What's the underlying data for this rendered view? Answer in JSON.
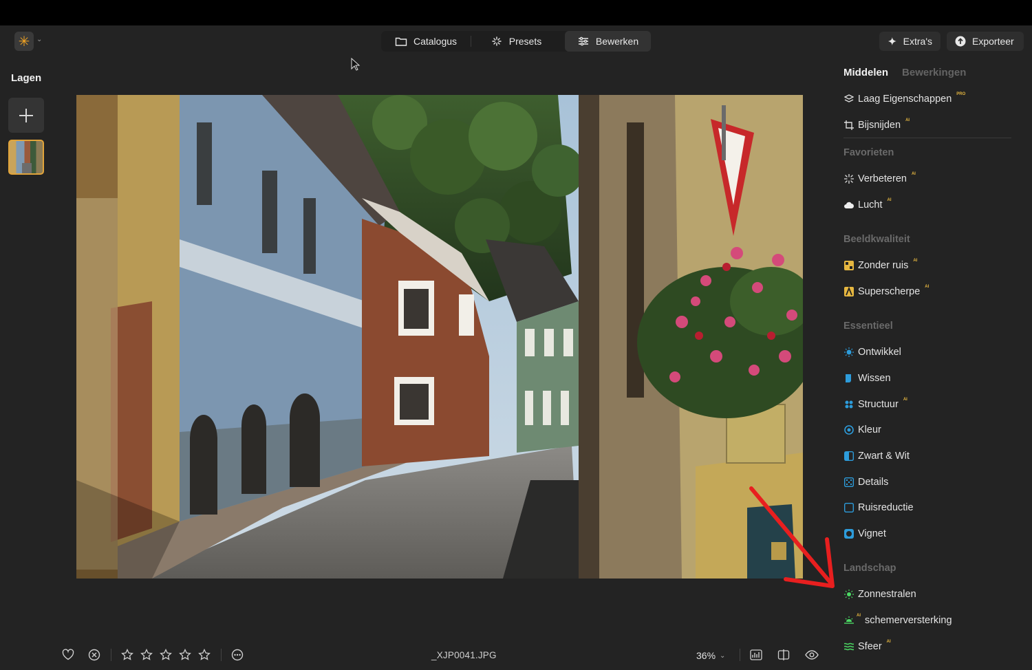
{
  "header": {
    "tabs": [
      {
        "label": "Catalogus",
        "icon": "folder-icon"
      },
      {
        "label": "Presets",
        "icon": "sparkle-icon"
      },
      {
        "label": "Bewerken",
        "icon": "sliders-icon"
      }
    ],
    "extras_label": "Extra's",
    "export_label": "Exporteer"
  },
  "layers": {
    "title": "Lagen"
  },
  "panel": {
    "tab_active": "Middelen",
    "tab_inactive": "Bewerkingen",
    "tools_top": [
      {
        "label": "Laag Eigenschappen",
        "badge": "PRO"
      },
      {
        "label": "Bijsnijden",
        "badge": "AI"
      }
    ],
    "sections": [
      "Favorieten",
      "Beeldkwaliteit",
      "Essentieel",
      "Landschap"
    ],
    "favorieten": [
      {
        "label": "Verbeteren",
        "badge": "AI"
      },
      {
        "label": "Lucht",
        "badge": "AI"
      }
    ],
    "beeldkwaliteit": [
      {
        "label": "Zonder ruis",
        "badge": "AI"
      },
      {
        "label": "Superscherpe",
        "badge": "AI"
      }
    ],
    "essentieel": [
      {
        "label": "Ontwikkel"
      },
      {
        "label": "Wissen"
      },
      {
        "label": "Structuur",
        "badge": "AI"
      },
      {
        "label": "Kleur"
      },
      {
        "label": "Zwart & Wit"
      },
      {
        "label": "Details"
      },
      {
        "label": "Ruisreductie"
      },
      {
        "label": "Vignet"
      }
    ],
    "landschap": [
      {
        "label": "Zonnestralen"
      },
      {
        "label": "schemerversterking",
        "badge": "AI"
      },
      {
        "label": "Sfeer",
        "badge": "AI"
      }
    ]
  },
  "footer": {
    "filename": "_XJP0041.JPG",
    "zoom": "36%",
    "rating_stars": 0,
    "rating_max": 5
  },
  "colors": {
    "accent_orange": "#f5a623",
    "thumb_border": "#e2a43a",
    "badge": "#e6b740",
    "annotation_arrow": "#e81f1f"
  }
}
